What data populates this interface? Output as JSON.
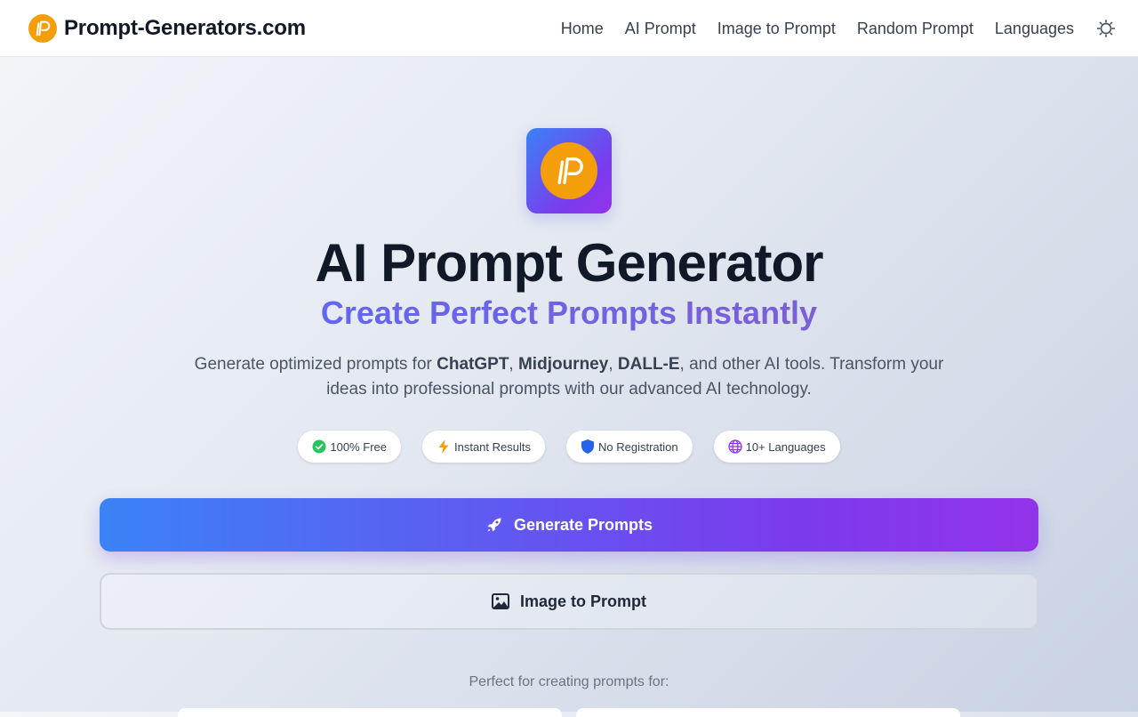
{
  "header": {
    "brand_name": "Prompt-Generators.com",
    "nav": [
      {
        "label": "Home"
      },
      {
        "label": "AI Prompt"
      },
      {
        "label": "Image to Prompt"
      },
      {
        "label": "Random Prompt"
      },
      {
        "label": "Languages"
      }
    ],
    "theme_icon": "sun-icon"
  },
  "hero": {
    "title": "AI Prompt Generator",
    "subtitle": "Create Perfect Prompts Instantly",
    "desc_prefix": "Generate optimized prompts for ",
    "desc_chatgpt": "ChatGPT",
    "desc_sep1": ", ",
    "desc_midjourney": "Midjourney",
    "desc_sep2": ", ",
    "desc_dalle": "DALL-E",
    "desc_suffix": ", and other AI tools. Transform your ideas into professional prompts with our advanced AI technology."
  },
  "badges": [
    {
      "label": "100% Free",
      "icon": "check-circle-icon"
    },
    {
      "label": "Instant Results",
      "icon": "lightning-icon"
    },
    {
      "label": "No Registration",
      "icon": "shield-icon"
    },
    {
      "label": "10+ Languages",
      "icon": "globe-icon"
    }
  ],
  "actions": {
    "generate_label": "Generate Prompts",
    "image_label": "Image to Prompt"
  },
  "perfect_for": "Perfect for creating prompts for:",
  "colors": {
    "accent_blue": "#3b82f6",
    "accent_purple": "#9333ea",
    "logo_orange": "#f59e0b"
  }
}
